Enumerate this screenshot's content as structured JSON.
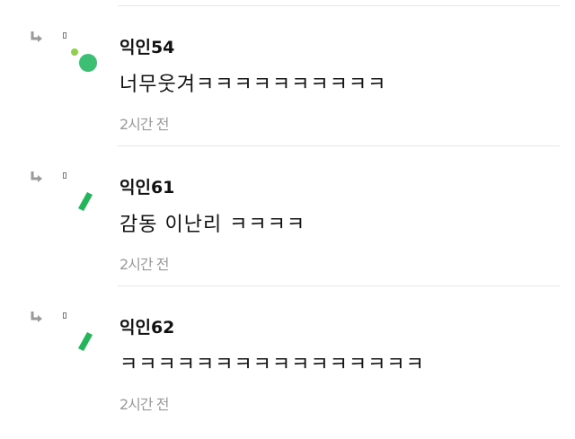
{
  "colors": {
    "green": "#22b55a",
    "light_green": "#8fd14f",
    "divider": "#e6e6e6",
    "meta": "#9a9a9a"
  },
  "comments": [
    {
      "nickname": "익인54",
      "text": "너무웃겨ㅋㅋㅋㅋㅋㅋㅋㅋㅋㅋ",
      "time": "2시간 전",
      "avatar_icon": "dot-emoji-icon",
      "reply_icon": "reply-arrow-icon"
    },
    {
      "nickname": "익인61",
      "text": "감동 이난리 ㅋㅋㅋㅋ",
      "time": "2시간 전",
      "avatar_icon": "green-slash-emoji-icon",
      "reply_icon": "reply-arrow-icon"
    },
    {
      "nickname": "익인62",
      "text": "ㅋㅋㅋㅋㅋㅋㅋㅋㅋㅋㅋㅋㅋㅋㅋㅋ",
      "time": "2시간 전",
      "avatar_icon": "green-slash-emoji-icon",
      "reply_icon": "reply-arrow-icon"
    }
  ]
}
